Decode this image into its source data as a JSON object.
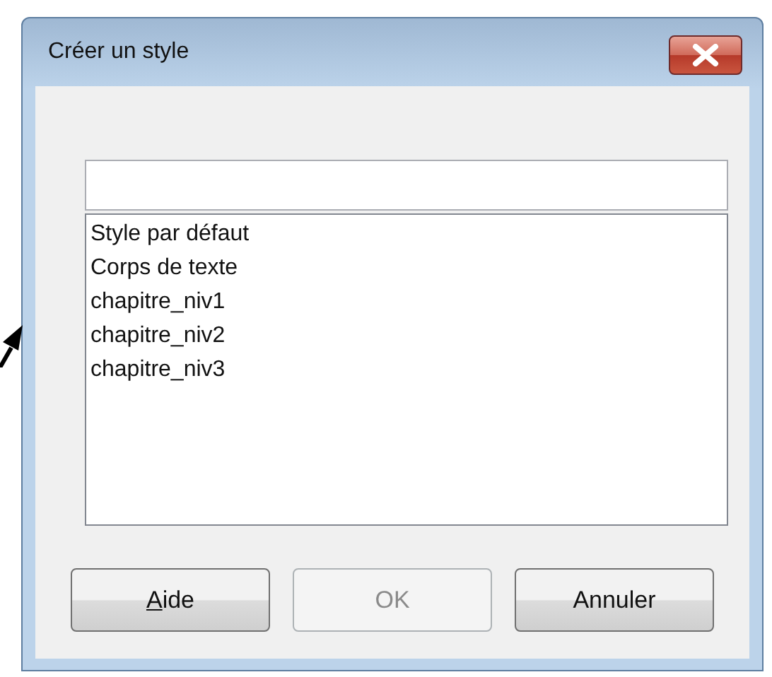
{
  "window": {
    "title": "Créer un style"
  },
  "styles_list": [
    {
      "label": "Style par défaut",
      "selected": false
    },
    {
      "label": "Corps de texte",
      "selected": false
    },
    {
      "label": "chapitre_niv1",
      "selected": false
    },
    {
      "label": "chapitre_niv2",
      "selected": false
    },
    {
      "label": "chapitre_niv3",
      "selected": false
    }
  ],
  "buttons": [
    {
      "mnemonic": "A",
      "rest": "ide",
      "disabled": false
    },
    {
      "rest": "OK",
      "disabled": true
    },
    {
      "rest": "Annuler",
      "disabled": false
    }
  ]
}
